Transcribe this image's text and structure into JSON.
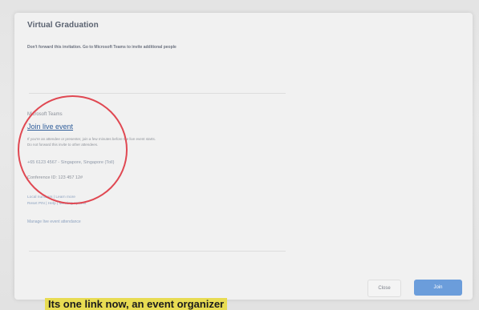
{
  "dialog": {
    "title": "Virtual Graduation",
    "subtitle": "Don't forward this invitation. Go to Microsoft Teams to invite additional people"
  },
  "teams": {
    "heading": "Microsoft Teams",
    "join_link": "Join live event",
    "info_line_1": "If you're an attendee or presenter, join a few minutes before the live event starts.",
    "info_line_2": "Do not forward this invite to other attendees.",
    "phone": "+65 6123 4567 - Singapore, Singapore (Toll)",
    "conference_id": "Conference ID: 123 457 12#",
    "local_numbers": "Local numbers | Learn more",
    "reset_pin": "Reset PIN | Help | Meeting options",
    "manage_link": "Manage live event attendance"
  },
  "buttons": {
    "close": "Close",
    "join": "Join"
  },
  "caption": "Its one link now, an event organizer",
  "colors": {
    "accent": "#6b9ddb",
    "link": "#2f5d9a",
    "highlight": "#e04852",
    "caption_bg": "#e8dc53"
  }
}
